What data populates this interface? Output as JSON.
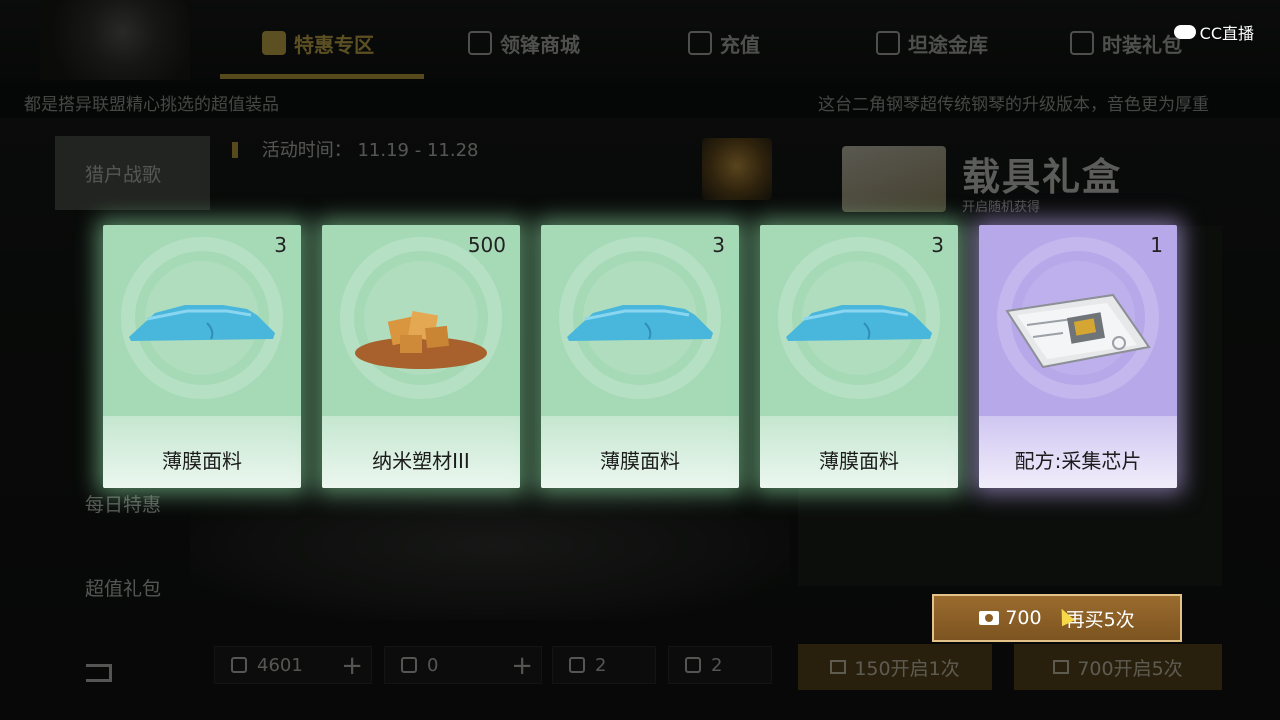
{
  "header": {
    "tabs": [
      {
        "label": "特惠专区",
        "active": true
      },
      {
        "label": "领锋商城",
        "active": false
      },
      {
        "label": "充值",
        "active": false
      },
      {
        "label": "坦途金库",
        "active": false
      },
      {
        "label": "时装礼包",
        "active": false
      }
    ],
    "ticker_left": "都是搭异联盟精心挑选的超值装品",
    "ticker_right": "这台二角钢琴超传统钢琴的升级版本，音色更为厚重"
  },
  "watermark": {
    "text": "CC直播"
  },
  "sidebar": {
    "items": [
      {
        "label": "猎户战歌",
        "active": true
      },
      {
        "label": "每日特惠",
        "active": false
      },
      {
        "label": "超值礼包",
        "active": false
      }
    ]
  },
  "activity": {
    "label": "活动时间：",
    "range": "11.19 - 11.28"
  },
  "gift": {
    "title": "载具礼盒",
    "subtitle": "开启随机获得"
  },
  "currencies": [
    {
      "icon": "gear-coin-icon",
      "value": "4601"
    },
    {
      "icon": "ticket-icon",
      "value": "0"
    },
    {
      "icon": "card-icon",
      "value": "2"
    },
    {
      "icon": "card-icon",
      "value": "2"
    }
  ],
  "open_buttons": [
    {
      "label": "150开启1次"
    },
    {
      "label": "700开启5次"
    }
  ],
  "rewards": [
    {
      "name": "薄膜面料",
      "qty": "3",
      "rarity": "green",
      "icon": "fabric-icon"
    },
    {
      "name": "纳米塑材III",
      "qty": "500",
      "rarity": "green",
      "icon": "nano-plastic-icon"
    },
    {
      "name": "薄膜面料",
      "qty": "3",
      "rarity": "green",
      "icon": "fabric-icon"
    },
    {
      "name": "薄膜面料",
      "qty": "3",
      "rarity": "green",
      "icon": "fabric-icon"
    },
    {
      "name": "配方:采集芯片",
      "qty": "1",
      "rarity": "purple",
      "icon": "blueprint-icon"
    }
  ],
  "buy_again": {
    "price": "700",
    "label": "再买5次"
  },
  "colors": {
    "card_green": "#a6dab7",
    "card_purple": "#b7a8ea",
    "buy_button": "#8a5d25",
    "tab_active": "#f3d35c"
  }
}
